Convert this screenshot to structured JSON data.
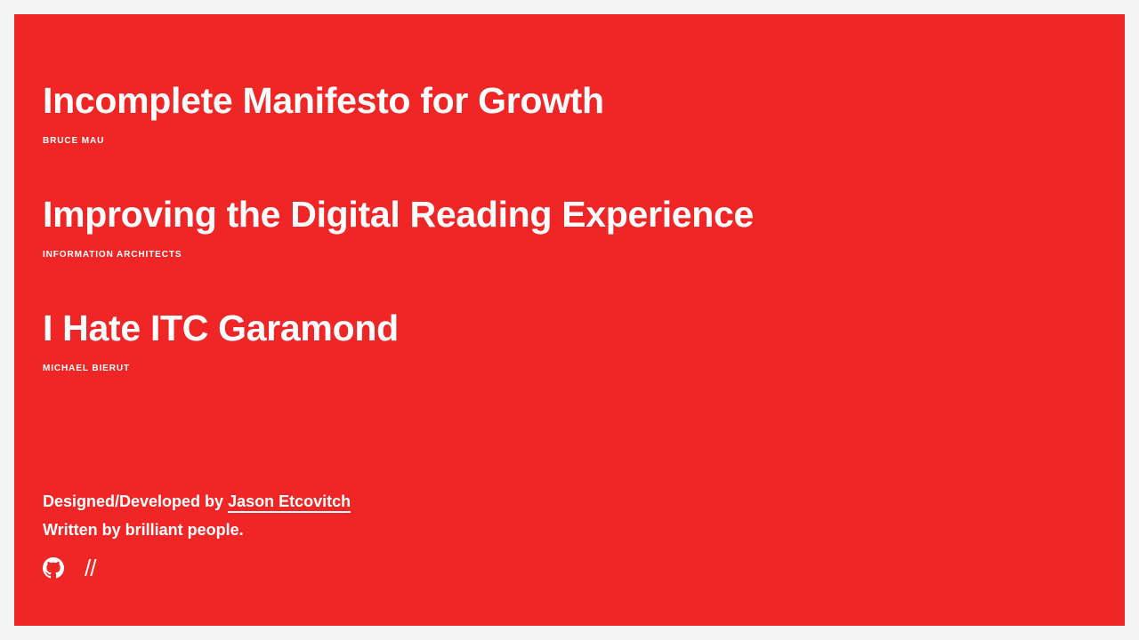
{
  "articles": [
    {
      "title": "Incomplete Manifesto for Growth",
      "author": "BRUCE MAU"
    },
    {
      "title": "Improving the Digital Reading Experience",
      "author": "INFORMATION ARCHITECTS"
    },
    {
      "title": "I Hate ITC Garamond",
      "author": "MICHAEL BIERUT"
    }
  ],
  "footer": {
    "designed_prefix": "Designed/Developed by ",
    "designer_name": "Jason Etcovitch",
    "written_by": "Written by brilliant people.",
    "slash_link": "//"
  },
  "icons": {
    "github": "github-icon"
  },
  "colors": {
    "background": "#f02626",
    "text": "#ffffff",
    "page": "#f4f4f4"
  }
}
